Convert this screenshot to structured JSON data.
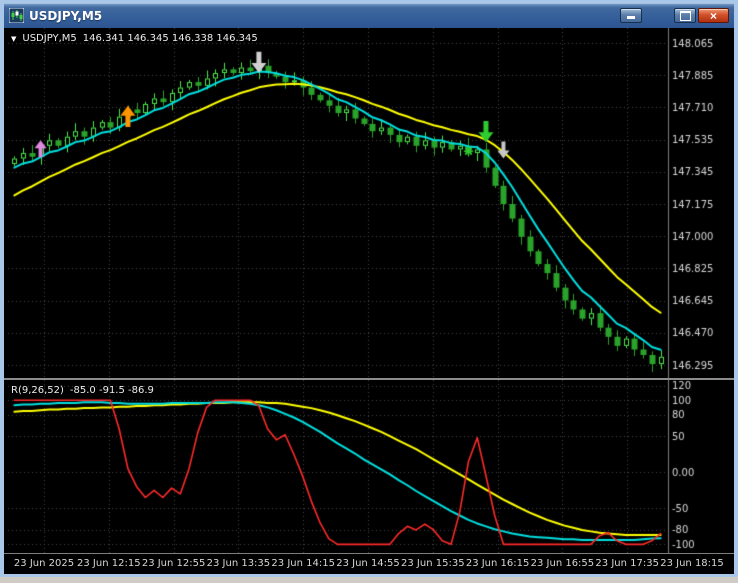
{
  "window": {
    "title": "USDJPY,M5",
    "controls": {
      "close_glyph": "×"
    }
  },
  "chart_data": {
    "type": "candlestick",
    "colors": {
      "bg": "#000000",
      "grid": "#454545",
      "axis_line": "#7d7d7d",
      "axis_text": "#d6d6d6",
      "bull": "#4ce64c",
      "bear": "#2aa32a",
      "ma_fast": "#00dfe0",
      "ma_slow": "#ffff00",
      "osc_fast": "#ff2b2b",
      "osc_mid": "#00dfe0",
      "osc_slow": "#ffff00"
    },
    "time_axis": [
      "23 Jun 2025",
      "23 Jun 12:15",
      "23 Jun 12:55",
      "23 Jun 13:35",
      "23 Jun 14:15",
      "23 Jun 14:55",
      "23 Jun 15:35",
      "23 Jun 16:15",
      "23 Jun 16:55",
      "23 Jun 17:35",
      "23 Jun 18:15"
    ],
    "time_x": [
      40,
      104.8,
      169.6,
      234.4,
      299.2,
      364,
      428.8,
      493.6,
      558.4,
      623.2,
      688
    ],
    "main": {
      "symbol_label": "USDJPY,M5",
      "ohlc_label": "146.341 146.345 146.338 146.345",
      "price_axis": [
        "148.065",
        "147.885",
        "147.710",
        "147.535",
        "147.345",
        "147.175",
        "147.000",
        "146.825",
        "146.645",
        "146.470",
        "146.295"
      ],
      "open_first": 147.4,
      "closes": [
        147.43,
        147.46,
        147.44,
        147.5,
        147.53,
        147.5,
        147.55,
        147.58,
        147.55,
        147.6,
        147.63,
        147.6,
        147.66,
        147.7,
        147.68,
        147.73,
        147.76,
        147.74,
        147.79,
        147.82,
        147.85,
        147.83,
        147.87,
        147.9,
        147.92,
        147.9,
        147.93,
        147.91,
        147.94,
        147.9,
        147.88,
        147.85,
        147.86,
        147.82,
        147.78,
        147.75,
        147.72,
        147.68,
        147.7,
        147.65,
        147.62,
        147.58,
        147.6,
        147.56,
        147.52,
        147.55,
        147.5,
        147.53,
        147.49,
        147.52,
        147.48,
        147.5,
        147.46,
        147.48,
        147.38,
        147.28,
        147.18,
        147.1,
        147.0,
        146.92,
        146.85,
        146.8,
        146.72,
        146.65,
        146.6,
        146.55,
        146.58,
        146.5,
        146.45,
        146.4,
        146.44,
        146.38,
        146.35,
        146.3,
        146.34
      ],
      "ma_fast_period": 6,
      "ma_fast_init": 147.36,
      "ma_slow_period": 16,
      "ma_slow_init": 147.2,
      "arrows": [
        {
          "type": "up",
          "color": "#e08ae0",
          "index": 3,
          "price": 147.53,
          "bold": false
        },
        {
          "type": "up",
          "color": "#ff9500",
          "index": 13,
          "price": 147.72,
          "bold": true
        },
        {
          "type": "down",
          "color": "#d0d0d0",
          "index": 28,
          "price": 147.9,
          "bold": true
        },
        {
          "type": "star",
          "color": "#2ecc2e",
          "index": 52,
          "price": 147.47,
          "bold": false
        },
        {
          "type": "down",
          "color": "#2ecc2e",
          "index": 54,
          "price": 147.52,
          "bold": true
        },
        {
          "type": "down",
          "color": "#c8c8c8",
          "index": 56,
          "price": 147.43,
          "bold": false
        }
      ]
    },
    "indicator": {
      "name_label": "R(9,26,52)",
      "values_label": "-85.0 -91.5 -86.9",
      "axis_labels": [
        "120",
        "100",
        "80",
        "50",
        "0.00",
        "-50",
        "-80",
        "-100"
      ],
      "levels": [
        120,
        100,
        80,
        50,
        0,
        -50,
        -80,
        -100
      ],
      "scale_max": 128,
      "scale_min": -112,
      "series": {
        "red": [
          100,
          100,
          100,
          100,
          100,
          100,
          100,
          100,
          100,
          100,
          100,
          100,
          60,
          5,
          -20,
          -35,
          -25,
          -35,
          -22,
          -30,
          5,
          55,
          90,
          100,
          100,
          100,
          100,
          100,
          92,
          60,
          45,
          52,
          25,
          -5,
          -40,
          -70,
          -92,
          -100,
          -100,
          -100,
          -100,
          -100,
          -100,
          -100,
          -85,
          -75,
          -80,
          -72,
          -80,
          -95,
          -100,
          -55,
          15,
          48,
          -5,
          -60,
          -100,
          -100,
          -100,
          -100,
          -100,
          -100,
          -100,
          -100,
          -100,
          -100,
          -100,
          -88,
          -84,
          -95,
          -100,
          -100,
          -100,
          -95,
          -85
        ],
        "cyan": [
          93,
          94,
          94,
          95,
          95,
          96,
          96,
          96,
          97,
          97,
          97,
          96,
          96,
          95,
          95,
          95,
          95,
          95,
          96,
          96,
          96,
          96,
          96,
          97,
          97,
          97,
          96,
          95,
          93,
          90,
          86,
          81,
          76,
          70,
          63,
          56,
          48,
          40,
          33,
          26,
          18,
          11,
          4,
          -3,
          -11,
          -18,
          -26,
          -33,
          -40,
          -47,
          -54,
          -60,
          -66,
          -71,
          -75,
          -79,
          -82,
          -85,
          -87,
          -89,
          -90,
          -91,
          -92,
          -93,
          -93,
          -94,
          -94,
          -94,
          -94,
          -94,
          -94,
          -94,
          -93,
          -92,
          -91.5
        ],
        "yellow": [
          84,
          85,
          85,
          86,
          87,
          87,
          88,
          88,
          89,
          89,
          90,
          90,
          91,
          91,
          92,
          92,
          93,
          93,
          94,
          94,
          95,
          95,
          96,
          96,
          96,
          97,
          97,
          97,
          97,
          96,
          96,
          95,
          93,
          91,
          89,
          86,
          83,
          79,
          75,
          71,
          66,
          61,
          56,
          50,
          44,
          38,
          32,
          25,
          18,
          11,
          4,
          -3,
          -10,
          -17,
          -24,
          -31,
          -38,
          -44,
          -50,
          -56,
          -61,
          -66,
          -70,
          -74,
          -77,
          -80,
          -82,
          -84,
          -85,
          -86,
          -87,
          -87,
          -87,
          -87,
          -86.9
        ]
      }
    }
  }
}
